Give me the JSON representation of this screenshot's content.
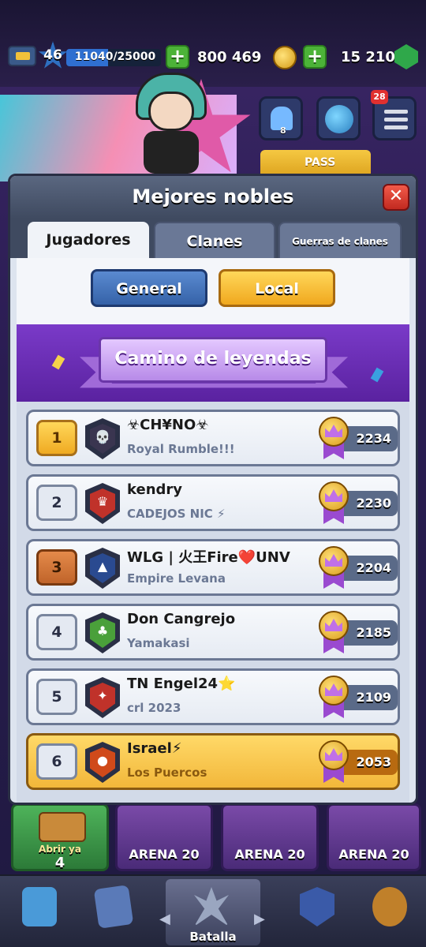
{
  "status": {
    "level": "46",
    "xp": "11040/25000",
    "xp_fraction": 0.44,
    "gold": "800 469",
    "gems": "15 210",
    "plus": "+"
  },
  "side": {
    "friends_count": "8",
    "notifications": "28",
    "pass_label": "PASS"
  },
  "modal": {
    "title": "Mejores nobles",
    "close": "✕",
    "tabs": [
      {
        "label": "Jugadores",
        "active": true
      },
      {
        "label": "Clanes",
        "active": false
      },
      {
        "label": "Guerras de clanes",
        "active": false
      }
    ],
    "scope": {
      "general": "General",
      "local": "Local",
      "selected": "Local"
    },
    "league": "Camino de leyendas",
    "rows": [
      {
        "rank": "1",
        "name": "☣CH¥NO☣",
        "clan": "Royal Rumble!!!",
        "score": "2234",
        "badge_color": "#3a3550",
        "badge_glyph": "💀",
        "rank_style": "gold",
        "me": false
      },
      {
        "rank": "2",
        "name": "kendry",
        "clan": "CADEJOS NIC ⚡",
        "score": "2230",
        "badge_color": "#c0322a",
        "badge_glyph": "♛",
        "rank_style": "plain",
        "me": false
      },
      {
        "rank": "3",
        "name": "WLG | 火王Fire❤️UNV",
        "clan": "Empire Levana",
        "score": "2204",
        "badge_color": "#2a4a90",
        "badge_glyph": "▲",
        "rank_style": "bronze",
        "me": false
      },
      {
        "rank": "4",
        "name": "Don Cangrejo",
        "clan": "Yamakasi",
        "score": "2185",
        "badge_color": "#4aa03a",
        "badge_glyph": "♣",
        "rank_style": "plain",
        "me": false
      },
      {
        "rank": "5",
        "name": "TN Engel24⭐",
        "clan": "crl 2023",
        "score": "2109",
        "badge_color": "#c0322a",
        "badge_glyph": "✦",
        "rank_style": "plain",
        "me": false
      },
      {
        "rank": "6",
        "name": "Israel⚡",
        "clan": "Los Puercos",
        "score": "2053",
        "badge_color": "#d04a1a",
        "badge_glyph": "●",
        "rank_style": "plain",
        "me": true
      }
    ]
  },
  "chests": {
    "open_label": "Abrir ya",
    "open_cost": "4",
    "arena_label": "ARENA 20"
  },
  "nav": {
    "battle_label": "Batalla"
  },
  "colors": {
    "accent_gold": "#f2b73a",
    "accent_blue": "#3562a8",
    "league_purple": "#7a3ac8"
  }
}
